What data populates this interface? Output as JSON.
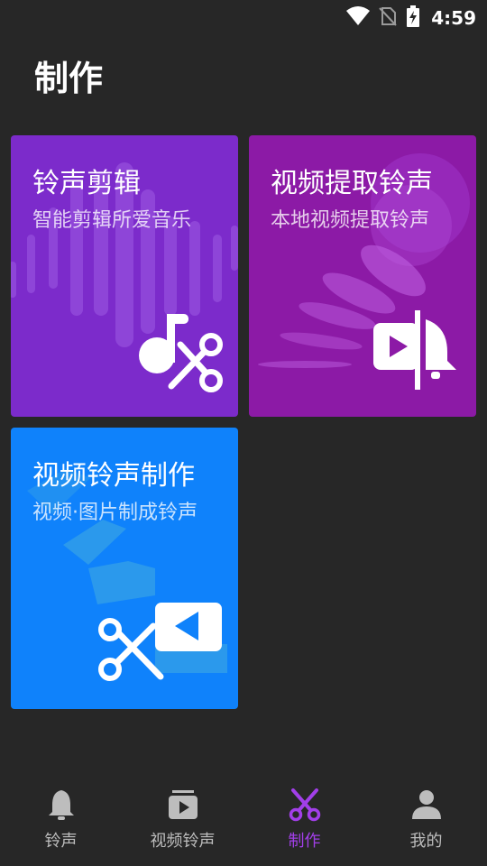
{
  "status_bar": {
    "time": "4:59"
  },
  "page": {
    "title": "制作"
  },
  "cards": [
    {
      "title": "铃声剪辑",
      "subtitle": "智能剪辑所爱音乐"
    },
    {
      "title": "视频提取铃声",
      "subtitle": "本地视频提取铃声"
    },
    {
      "title": "视频铃声制作",
      "subtitle": "视频·图片制成铃声"
    }
  ],
  "bottom_nav": [
    {
      "label": "铃声",
      "icon": "bell-icon"
    },
    {
      "label": "视频铃声",
      "icon": "video-playlist-icon"
    },
    {
      "label": "制作",
      "icon": "scissors-icon"
    },
    {
      "label": "我的",
      "icon": "person-icon"
    }
  ],
  "colors": {
    "background": "#272727",
    "card_music_cut": "#7c2bcb",
    "card_video_extract": "#8c1aa6",
    "card_video_make": "#0f82fb",
    "nav_active": "#a23fe9",
    "nav_inactive": "#bdbdbd"
  }
}
